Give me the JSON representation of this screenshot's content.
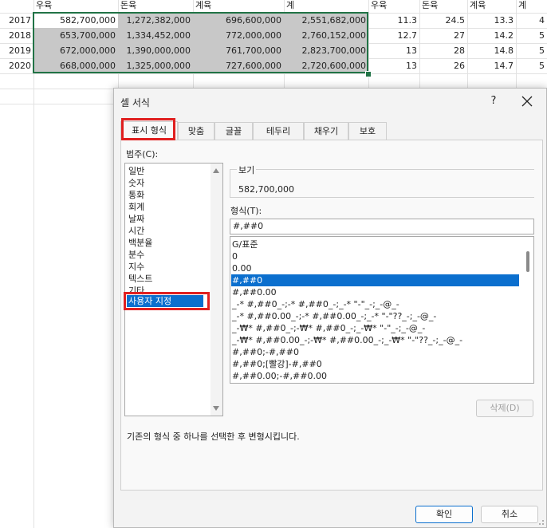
{
  "sheet": {
    "headers": [
      "우육",
      "돈육",
      "계육",
      "계",
      "우육",
      "돈육",
      "계육",
      "계"
    ],
    "rows": [
      {
        "year": "2017",
        "beef": "582,700,000",
        "pork": "1,272,382,000",
        "chicken": "696,600,000",
        "total": "2,551,682,000",
        "r_beef": "11.3",
        "r_pork": "24.5",
        "r_chicken": "13.3",
        "r_total": "4"
      },
      {
        "year": "2018",
        "beef": "653,700,000",
        "pork": "1,334,452,000",
        "chicken": "772,000,000",
        "total": "2,760,152,000",
        "r_beef": "12.7",
        "r_pork": "27",
        "r_chicken": "14.2",
        "r_total": "5"
      },
      {
        "year": "2019",
        "beef": "672,000,000",
        "pork": "1,390,000,000",
        "chicken": "761,700,000",
        "total": "2,823,700,000",
        "r_beef": "13",
        "r_pork": "28",
        "r_chicken": "14.8",
        "r_total": "5"
      },
      {
        "year": "2020",
        "beef": "668,000,000",
        "pork": "1,325,000,000",
        "chicken": "727,600,000",
        "total": "2,720,600,000",
        "r_beef": "13",
        "r_pork": "26",
        "r_chicken": "14.7",
        "r_total": "5"
      }
    ],
    "selection_color": "#217346"
  },
  "dialog": {
    "title": "셀 서식",
    "help": "?",
    "tabs": [
      "표시 형식",
      "맞춤",
      "글꼴",
      "테두리",
      "채우기",
      "보호"
    ],
    "active_tab": "표시 형식",
    "category_label": "범주(C):",
    "categories": [
      "일반",
      "숫자",
      "통화",
      "회계",
      "날짜",
      "시간",
      "백분율",
      "분수",
      "지수",
      "텍스트",
      "기타",
      "사용자 지정"
    ],
    "selected_category": "사용자 지정",
    "sample_label": "보기",
    "sample_value": "582,700,000",
    "type_label": "형식(T):",
    "type_value": "#,##0",
    "formats": [
      "G/표준",
      "0",
      "0.00",
      "#,##0",
      "#,##0.00",
      "_-* #,##0_-;-* #,##0_-;_-* \"-\"_-;_-@_-",
      "_-* #,##0.00_-;-* #,##0.00_-;_-* \"-\"??_-;_-@_-",
      "_-₩* #,##0_-;-₩* #,##0_-;_-₩* \"-\"_-;_-@_-",
      "_-₩* #,##0.00_-;-₩* #,##0.00_-;_-₩* \"-\"??_-;_-@_-",
      "#,##0;-#,##0",
      "#,##0;[빨강]-#,##0",
      "#,##0.00;-#,##0.00"
    ],
    "selected_format": "#,##0",
    "delete_button": "삭제(D)",
    "description": "기존의 형식 중 하나를 선택한 후 변형시킵니다.",
    "ok_button": "확인",
    "cancel_button": "취소",
    "highlight_color": "#e02020",
    "accent_color": "#0b6fce"
  }
}
